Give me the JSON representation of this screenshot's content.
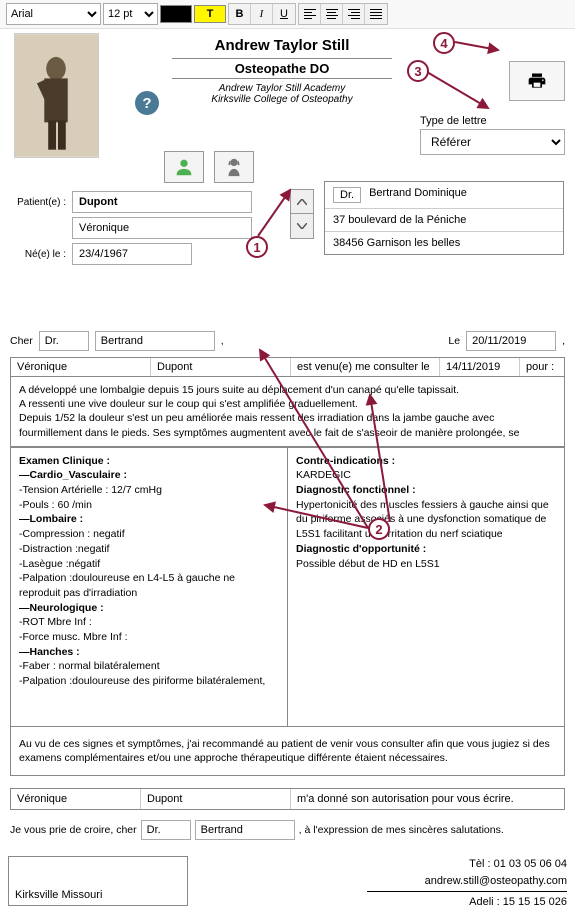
{
  "toolbar": {
    "font": "Arial",
    "size": "12 pt",
    "bold": "B",
    "italic": "I",
    "underline": "U",
    "highlight_letter": "T"
  },
  "title": {
    "name": "Andrew Taylor Still",
    "role": "Osteopathe DO",
    "school1": "Andrew Taylor Still Academy",
    "school2": "Kirksville College of Osteopathy"
  },
  "letter_type": {
    "label": "Type de lettre",
    "value": "Référer"
  },
  "patient": {
    "label": "Patient(e) :",
    "lastname": "Dupont",
    "firstname": "Véronique",
    "dob_label": "Né(e) le :",
    "dob": "23/4/1967"
  },
  "practitioner": {
    "title": "Dr.",
    "name": "Bertrand Dominique",
    "addr1": "37 boulevard de la Péniche",
    "addr2": "38456 Garnison les belles"
  },
  "salutation": {
    "cher": "Cher",
    "title": "Dr.",
    "name": "Bertrand"
  },
  "date": {
    "label": "Le",
    "value": "20/11/2019"
  },
  "visit": {
    "firstname": "Véronique",
    "lastname": "Dupont",
    "text": "est venu(e) me consulter le",
    "date": "14/11/2019",
    "for": "pour :"
  },
  "history": "A développé une lombalgie depuis 15 jours suite au déplacement d'un canapé qu'elle tapissait.\nA ressenti une vive douleur sur le coup qui s'est amplifiée graduellement.\nDepuis 1/52 la douleur s'est un peu améliorée mais ressent des irradiation dans la jambe gauche avec fourmillement dans le pieds. Ses symptômes augmentent avec le fait de s'asseoir de manière prolongée, se",
  "exam": {
    "heading": "Examen Clinique :",
    "cv": "—Cardio_Vasculaire :",
    "ta": "-Tension Artérielle : 12/7 cmHg",
    "pouls": "-Pouls : 60 /min",
    "lomb": "—Lombaire :",
    "comp": "-Compression : negatif",
    "dist": "-Distraction :negatif",
    "laseg": "-Lasègue :négatif",
    "palp": "-Palpation :douloureuse en L4-L5 à gauche ne reproduit pas d'irradiation",
    "neuro": "—Neurologique :",
    "rot": "-ROT Mbre Inf :",
    "force": "-Force musc. Mbre Inf :",
    "hanche": "—Hanches  :",
    "faber": "-Faber : normal bilatéralement",
    "palp2": "-Palpation :douloureuse des piriforme bilatéralement,"
  },
  "diag": {
    "ci": "Contre-indications :",
    "ci_v": "KARDEGIC",
    "fonc": "Diagnostic fonctionnel :",
    "fonc_v": "Hypertonicité des muscles fessiers à gauche ainsi que du piriforme associés à une dysfonction somatique de L5S1 facilitant une irritation du nerf sciatique",
    "opp": "Diagnostic d'opportunité :",
    "opp_v": "Possible début de HD en L5S1"
  },
  "reco": "Au vu de ces signes et symptômes, j'ai recommandé au patient de venir vous consulter afin que vous jugiez si des examens complémentaires et/ou une approche thérapeutique différente étaient nécessaires.",
  "auth": {
    "firstname": "Véronique",
    "lastname": "Dupont",
    "text": "m'a donné son autorisation pour vous écrire."
  },
  "closing": {
    "pre": "Je vous prie de croire,  cher",
    "title": "Dr.",
    "name": "Bertrand",
    "post": ", à l'expression de mes sincères salutations."
  },
  "footer": {
    "city": "Kirksville Missouri",
    "tel": "Tèl : 01 03 05 06 04",
    "email": "andrew.still@osteopathy.com",
    "adeli": "Adeli : 15 15 15 026"
  },
  "callouts": {
    "c1": "1",
    "c2": "2",
    "c3": "3",
    "c4": "4"
  }
}
